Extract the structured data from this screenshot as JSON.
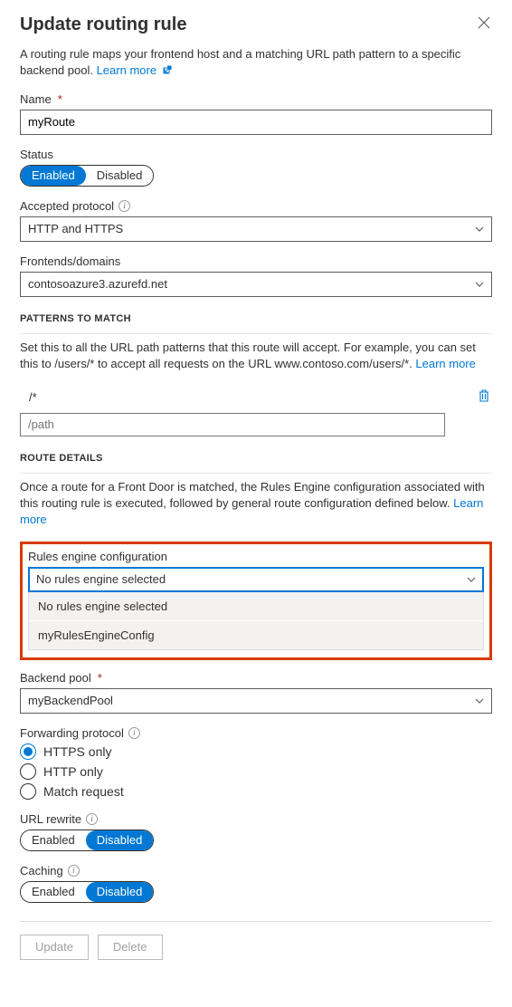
{
  "header": {
    "title": "Update routing rule",
    "description_pre": "A routing rule maps your frontend host and a matching URL path pattern to a specific backend pool. ",
    "learn_more": "Learn more"
  },
  "name": {
    "label": "Name",
    "value": "myRoute"
  },
  "status": {
    "label": "Status",
    "enabled": "Enabled",
    "disabled": "Disabled"
  },
  "protocol": {
    "label": "Accepted protocol",
    "value": "HTTP and HTTPS"
  },
  "frontends": {
    "label": "Frontends/domains",
    "value": "contosoazure3.azurefd.net"
  },
  "patterns": {
    "heading": "PATTERNS TO MATCH",
    "desc_pre": "Set this to all the URL path patterns that this route will accept. For example, you can set this to /users/* to accept all requests on the URL www.contoso.com/users/*. ",
    "learn_more": "Learn more",
    "existing": "/*",
    "placeholder": "/path"
  },
  "route_details": {
    "heading": "ROUTE DETAILS",
    "desc_pre": "Once a route for a Front Door is matched, the Rules Engine configuration associated with this routing rule is executed, followed by general route configuration defined below. ",
    "learn_more": "Learn more"
  },
  "rules_engine": {
    "label": "Rules engine configuration",
    "selected": "No rules engine selected",
    "options": [
      "No rules engine selected",
      "myRulesEngineConfig"
    ]
  },
  "backend": {
    "label": "Backend pool",
    "value": "myBackendPool"
  },
  "fwd_protocol": {
    "label": "Forwarding protocol",
    "opts": [
      "HTTPS only",
      "HTTP only",
      "Match request"
    ]
  },
  "url_rewrite": {
    "label": "URL rewrite",
    "enabled": "Enabled",
    "disabled": "Disabled"
  },
  "caching": {
    "label": "Caching",
    "enabled": "Enabled",
    "disabled": "Disabled"
  },
  "footer": {
    "update": "Update",
    "delete": "Delete"
  }
}
